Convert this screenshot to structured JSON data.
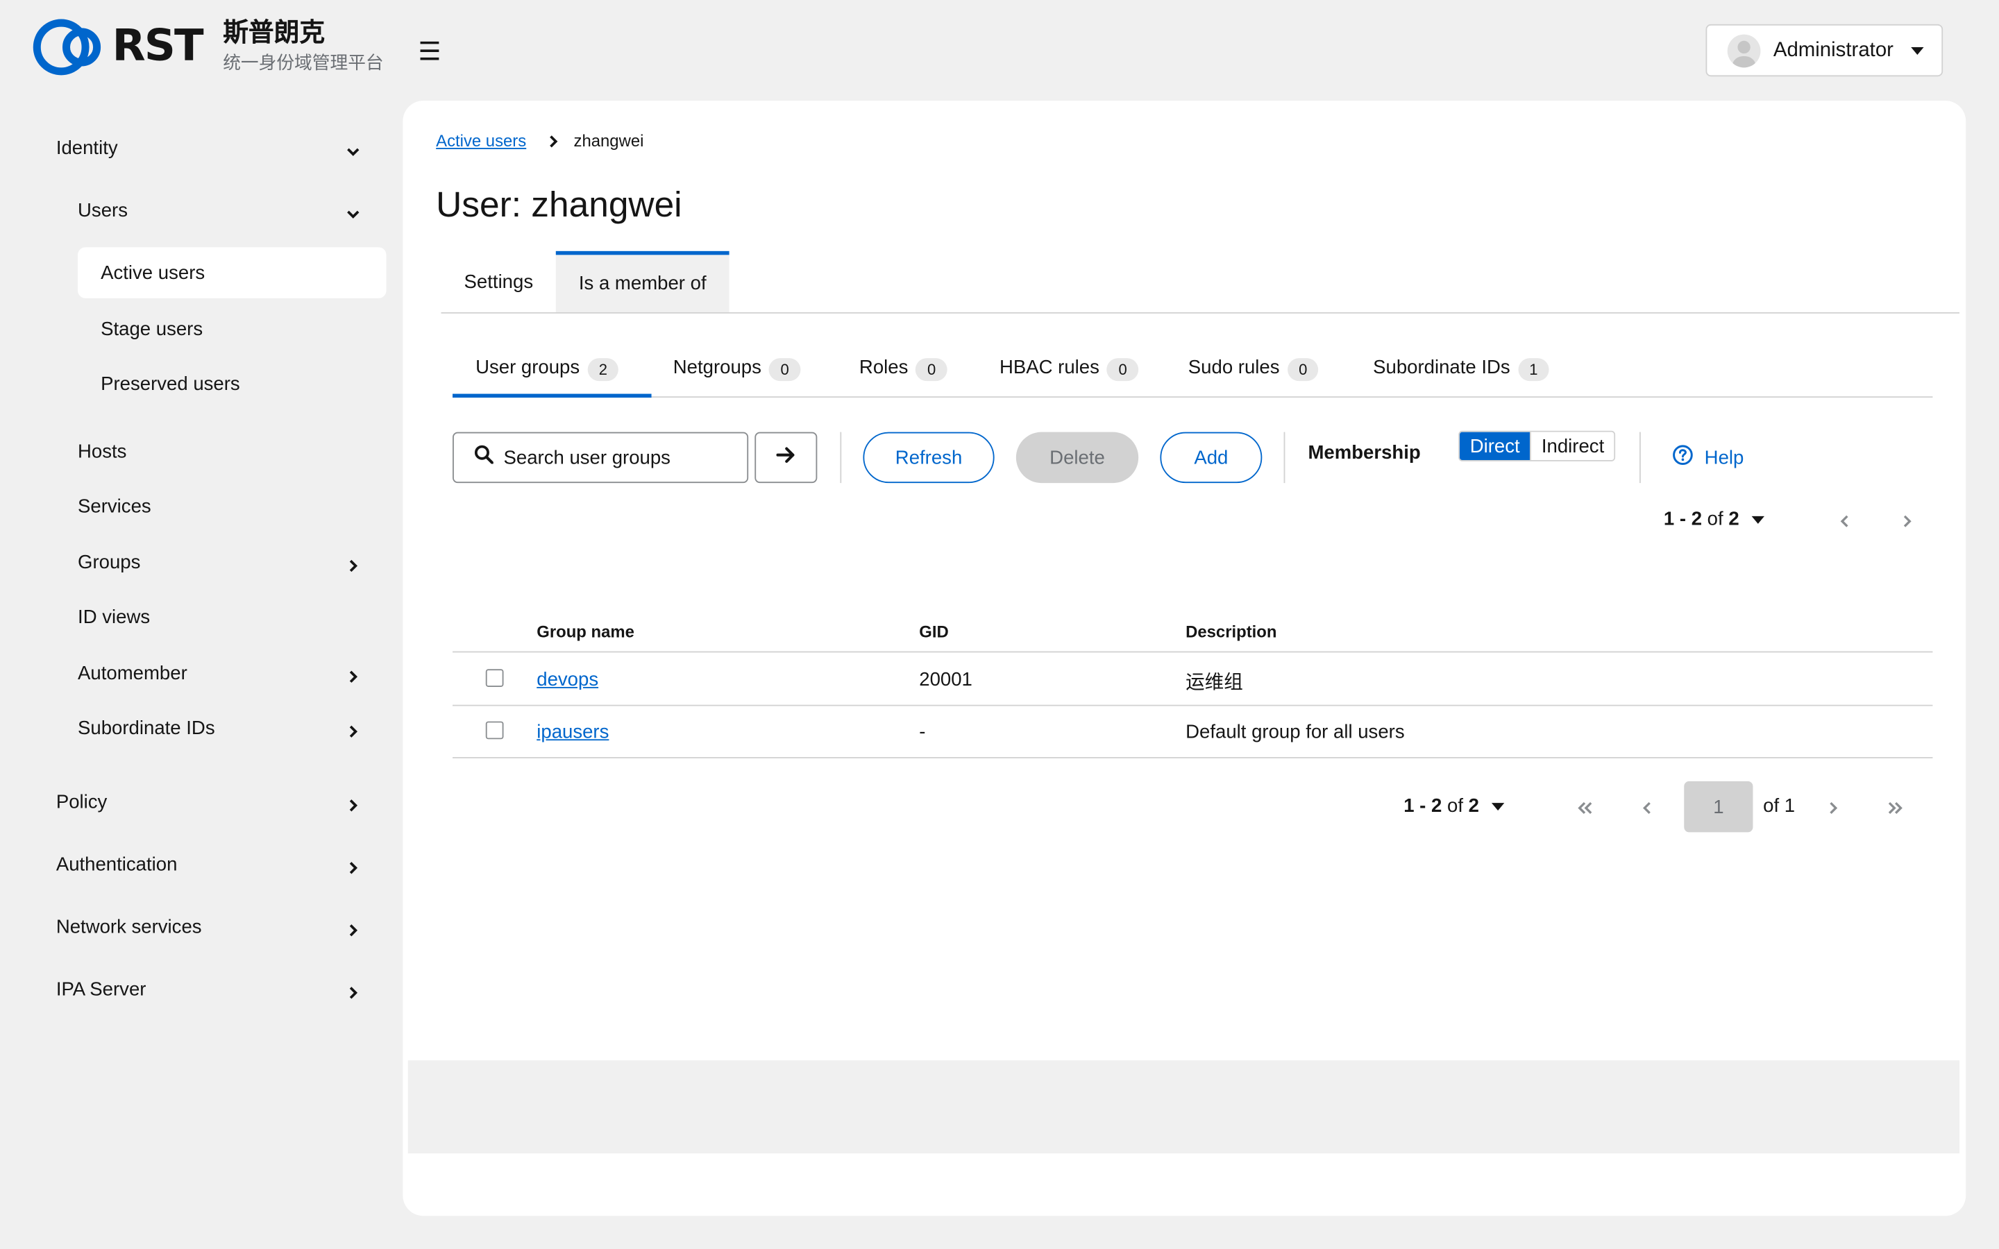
{
  "brand": {
    "logo_text": "RST",
    "title_cn": "斯普朗克",
    "subtitle_cn": "统一身份域管理平台"
  },
  "header": {
    "menu_icon": "hamburger-icon",
    "user_name": "Administrator"
  },
  "sidebar": {
    "identity": "Identity",
    "users": "Users",
    "active_users": "Active users",
    "stage_users": "Stage users",
    "preserved_users": "Preserved users",
    "hosts": "Hosts",
    "services": "Services",
    "groups": "Groups",
    "id_views": "ID views",
    "automember": "Automember",
    "subordinate_ids": "Subordinate IDs",
    "policy": "Policy",
    "authentication": "Authentication",
    "network_services": "Network services",
    "ipa_server": "IPA Server"
  },
  "breadcrumb": {
    "parent": "Active users",
    "current": "zhangwei"
  },
  "page_title": "User: zhangwei",
  "tabs": {
    "settings": "Settings",
    "member_of": "Is a member of"
  },
  "subtabs": [
    {
      "label": "User groups",
      "count": "2"
    },
    {
      "label": "Netgroups",
      "count": "0"
    },
    {
      "label": "Roles",
      "count": "0"
    },
    {
      "label": "HBAC rules",
      "count": "0"
    },
    {
      "label": "Sudo rules",
      "count": "0"
    },
    {
      "label": "Subordinate IDs",
      "count": "1"
    }
  ],
  "toolbar": {
    "search_placeholder": "Search user groups",
    "refresh": "Refresh",
    "delete": "Delete",
    "add": "Add",
    "membership_label": "Membership",
    "direct": "Direct",
    "indirect": "Indirect",
    "help": "Help"
  },
  "pagination": {
    "range": "1 - 2",
    "of_word": "of",
    "total": "2",
    "page": "1",
    "of_pages": "of 1"
  },
  "table": {
    "headers": {
      "name": "Group name",
      "gid": "GID",
      "description": "Description"
    },
    "rows": [
      {
        "name": "devops",
        "gid": "20001",
        "description": "运维组"
      },
      {
        "name": "ipausers",
        "gid": "-",
        "description": "Default group for all users"
      }
    ]
  },
  "colors": {
    "accent": "#0066cc",
    "background": "#f0f0f0",
    "border": "#d2d2d2"
  }
}
